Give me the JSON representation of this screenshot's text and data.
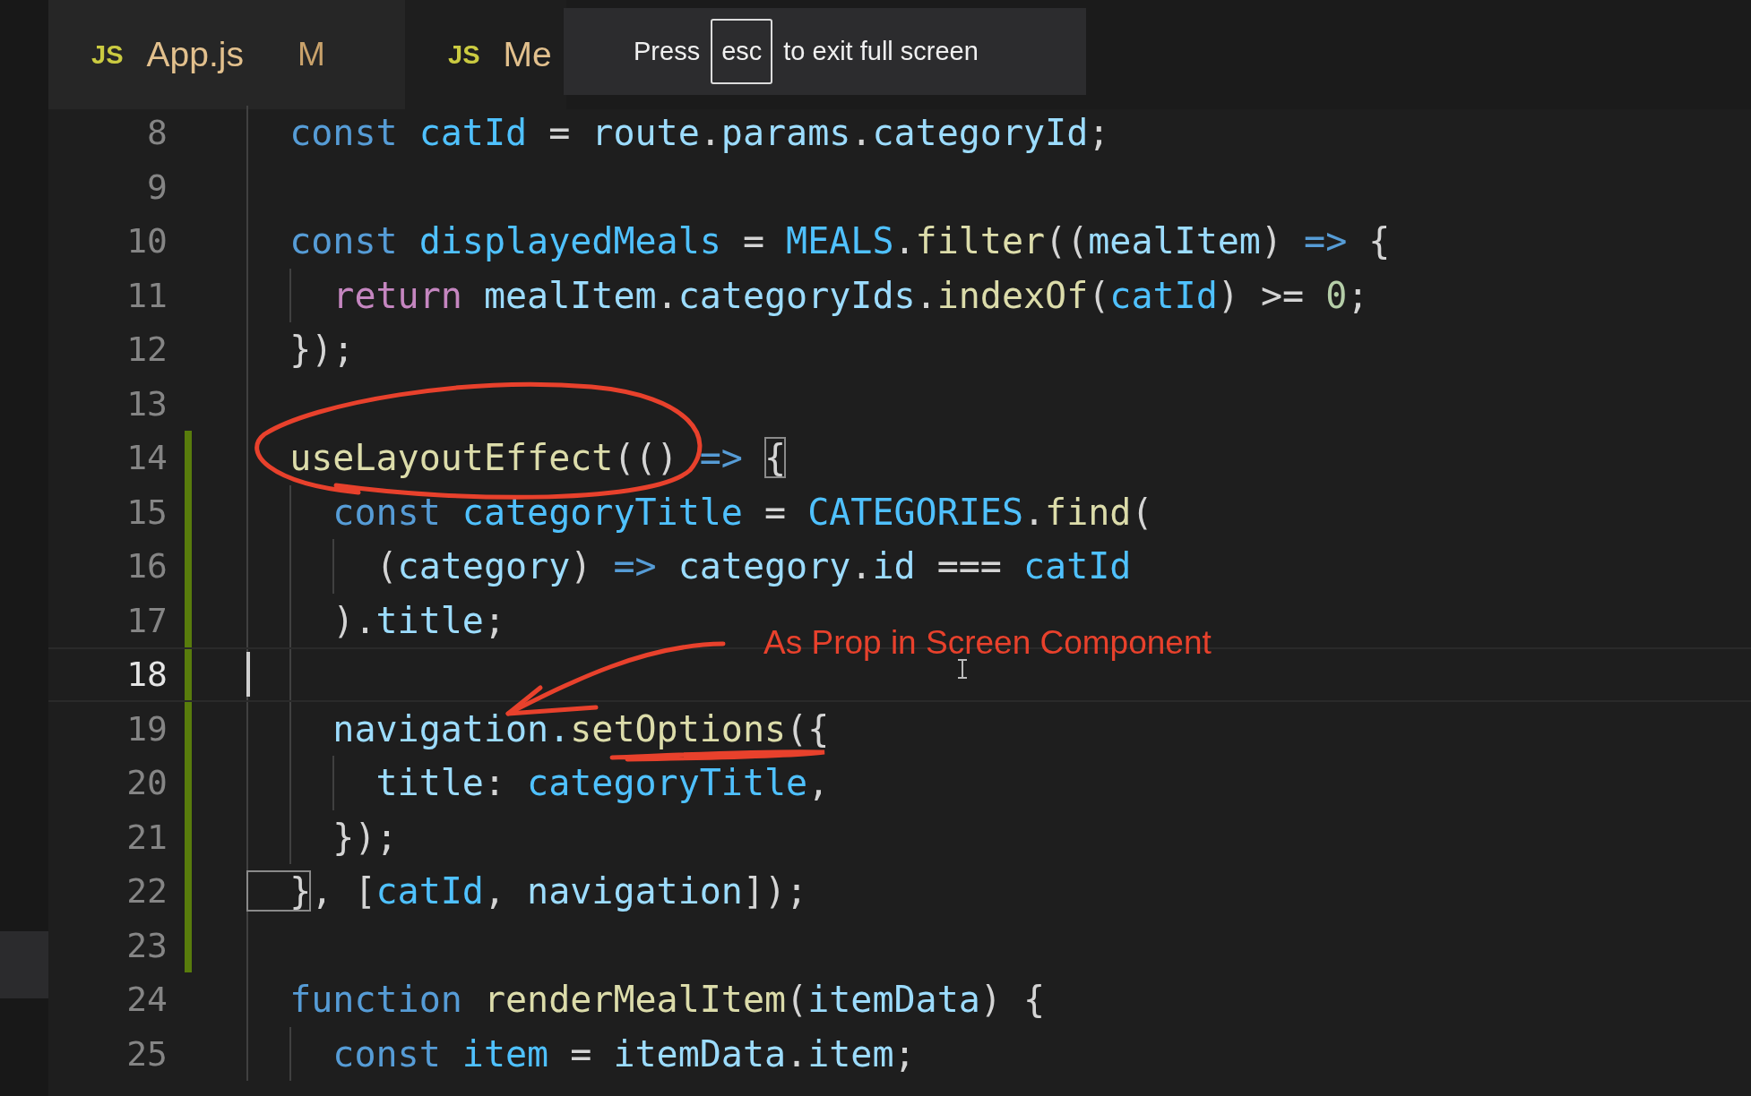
{
  "tabs": [
    {
      "icon": "JS",
      "label": "App.js",
      "status": "M",
      "selected": false
    },
    {
      "icon": "JS",
      "label": "Me",
      "selected": true
    }
  ],
  "fullscreen_notice": {
    "before": "Press",
    "key": "esc",
    "after": "to exit full screen"
  },
  "lines": [
    {
      "number": "8",
      "modified": false,
      "current": false,
      "tokens": [
        {
          "text": "  const ",
          "kind": "keyword"
        },
        {
          "text": "catId",
          "kind": "constant"
        },
        {
          "text": " = ",
          "kind": "plain"
        },
        {
          "text": "route",
          "kind": "variable"
        },
        {
          "text": ".",
          "kind": "plain"
        },
        {
          "text": "params",
          "kind": "variable"
        },
        {
          "text": ".",
          "kind": "plain"
        },
        {
          "text": "categoryId",
          "kind": "variable"
        },
        {
          "text": ";",
          "kind": "plain"
        }
      ]
    },
    {
      "number": "9",
      "modified": false,
      "current": false
    },
    {
      "number": "10",
      "modified": false,
      "current": false,
      "tokens": [
        {
          "text": "  const ",
          "kind": "keyword"
        },
        {
          "text": "displayedMeals",
          "kind": "constant"
        },
        {
          "text": " = ",
          "kind": "plain"
        },
        {
          "text": "MEALS",
          "kind": "constant"
        },
        {
          "text": ".",
          "kind": "plain"
        },
        {
          "text": "filter",
          "kind": "function"
        },
        {
          "text": "((",
          "kind": "plain"
        },
        {
          "text": "mealItem",
          "kind": "variable"
        },
        {
          "text": ") ",
          "kind": "plain"
        },
        {
          "text": "=>",
          "kind": "keyword"
        },
        {
          "text": " {",
          "kind": "plain"
        }
      ]
    },
    {
      "number": "11",
      "modified": false,
      "current": false,
      "tokens": [
        {
          "text": "    return ",
          "kind": "control"
        },
        {
          "text": "mealItem",
          "kind": "variable"
        },
        {
          "text": ".",
          "kind": "plain"
        },
        {
          "text": "categoryIds",
          "kind": "variable"
        },
        {
          "text": ".",
          "kind": "plain"
        },
        {
          "text": "indexOf",
          "kind": "function"
        },
        {
          "text": "(",
          "kind": "plain"
        },
        {
          "text": "catId",
          "kind": "constant"
        },
        {
          "text": ") >= ",
          "kind": "plain"
        },
        {
          "text": "0",
          "kind": "number"
        },
        {
          "text": ";",
          "kind": "plain"
        }
      ]
    },
    {
      "number": "12",
      "modified": false,
      "current": false,
      "tokens": [
        {
          "text": "  });",
          "kind": "plain"
        }
      ]
    },
    {
      "number": "13",
      "modified": false,
      "current": false
    },
    {
      "number": "14",
      "modified": true,
      "current": false,
      "tokens": [
        {
          "text": "  useLayoutEffect",
          "kind": "function"
        },
        {
          "text": "(() ",
          "kind": "plain"
        },
        {
          "text": "=> ",
          "kind": "keyword"
        },
        {
          "text": "{",
          "kind": "bracket"
        }
      ]
    },
    {
      "number": "15",
      "modified": true,
      "current": false,
      "tokens": [
        {
          "text": "    const ",
          "kind": "keyword"
        },
        {
          "text": "categoryTitle",
          "kind": "constant"
        },
        {
          "text": " = ",
          "kind": "plain"
        },
        {
          "text": "CATEGORIES",
          "kind": "constant"
        },
        {
          "text": ".",
          "kind": "plain"
        },
        {
          "text": "find",
          "kind": "function"
        },
        {
          "text": "(",
          "kind": "plain"
        }
      ]
    },
    {
      "number": "16",
      "modified": true,
      "current": false,
      "tokens": [
        {
          "text": "      (",
          "kind": "plain"
        },
        {
          "text": "category",
          "kind": "variable"
        },
        {
          "text": ") ",
          "kind": "plain"
        },
        {
          "text": "=> ",
          "kind": "keyword"
        },
        {
          "text": "category",
          "kind": "variable"
        },
        {
          "text": ".",
          "kind": "plain"
        },
        {
          "text": "id",
          "kind": "variable"
        },
        {
          "text": " === ",
          "kind": "plain"
        },
        {
          "text": "catId",
          "kind": "constant"
        }
      ]
    },
    {
      "number": "17",
      "modified": true,
      "current": false,
      "tokens": [
        {
          "text": "    ).",
          "kind": "plain"
        },
        {
          "text": "title",
          "kind": "variable"
        },
        {
          "text": ";",
          "kind": "plain"
        }
      ]
    },
    {
      "number": "18",
      "modified": true,
      "current": true
    },
    {
      "number": "19",
      "modified": true,
      "current": false,
      "tokens": [
        {
          "text": "    navigation.",
          "kind": "variable"
        },
        {
          "text": "setOptions",
          "kind": "function"
        },
        {
          "text": "({",
          "kind": "plain"
        }
      ]
    },
    {
      "number": "20",
      "modified": true,
      "current": false,
      "tokens": [
        {
          "text": "      title",
          "kind": "variable"
        },
        {
          "text": ": ",
          "kind": "plain"
        },
        {
          "text": "categoryTitle",
          "kind": "constant"
        },
        {
          "text": ",",
          "kind": "plain"
        }
      ]
    },
    {
      "number": "21",
      "modified": true,
      "current": false,
      "tokens": [
        {
          "text": "    });",
          "kind": "plain"
        }
      ]
    },
    {
      "number": "22",
      "modified": true,
      "current": false,
      "tokens": [
        {
          "text": "  }",
          "kind": "bracket"
        },
        {
          "text": ", [",
          "kind": "plain"
        },
        {
          "text": "catId",
          "kind": "constant"
        },
        {
          "text": ", ",
          "kind": "plain"
        },
        {
          "text": "navigation",
          "kind": "variable"
        },
        {
          "text": "]);",
          "kind": "plain"
        }
      ]
    },
    {
      "number": "23",
      "modified": true,
      "current": false
    },
    {
      "number": "24",
      "modified": false,
      "current": false,
      "tokens": [
        {
          "text": "  function ",
          "kind": "keyword"
        },
        {
          "text": "renderMealItem",
          "kind": "function"
        },
        {
          "text": "(",
          "kind": "plain"
        },
        {
          "text": "itemData",
          "kind": "variable"
        },
        {
          "text": ") {",
          "kind": "plain"
        }
      ]
    },
    {
      "number": "25",
      "modified": false,
      "current": false,
      "tokens": [
        {
          "text": "    const ",
          "kind": "keyword"
        },
        {
          "text": "item",
          "kind": "constant"
        },
        {
          "text": " = ",
          "kind": "plain"
        },
        {
          "text": "itemData",
          "kind": "variable"
        },
        {
          "text": ".",
          "kind": "plain"
        },
        {
          "text": "item",
          "kind": "variable"
        },
        {
          "text": ";",
          "kind": "plain"
        }
      ]
    }
  ],
  "annotation": {
    "text": "As Prop in Screen Component"
  }
}
